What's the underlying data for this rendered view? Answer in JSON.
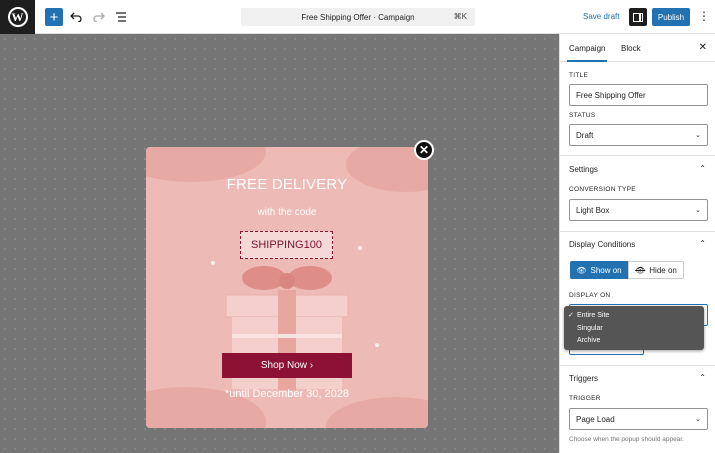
{
  "header": {
    "command_title": "Free Shipping Offer · Campaign",
    "command_shortcut": "⌘K",
    "save_draft": "Save draft",
    "publish": "Publish",
    "more": "⋮"
  },
  "popup": {
    "title": "FREE DELIVERY",
    "subtitle": "with the code",
    "code": "SHIPPING100",
    "cta": "Shop Now ›",
    "until": "*until December 30, 2028"
  },
  "sidebar": {
    "tabs": [
      "Campaign",
      "Block"
    ],
    "title_label": "TITLE",
    "title_value": "Free Shipping Offer",
    "status_label": "STATUS",
    "status_value": "Draft",
    "settings_heading": "Settings",
    "conversion_label": "CONVERSION TYPE",
    "conversion_value": "Light Box",
    "display_heading": "Display Conditions",
    "show_on": "Show on",
    "hide_on": "Hide on",
    "display_on_label": "DISPLAY ON",
    "display_options": [
      "Entire Site",
      "Singular",
      "Archive"
    ],
    "triggers_heading": "Triggers",
    "trigger_label": "TRIGGER",
    "trigger_value": "Page Load",
    "trigger_help": "Choose when the popup should appear."
  },
  "colors": {
    "accent": "#2271b1",
    "popup_bg": "#eebab5",
    "cta": "#8c1135"
  }
}
